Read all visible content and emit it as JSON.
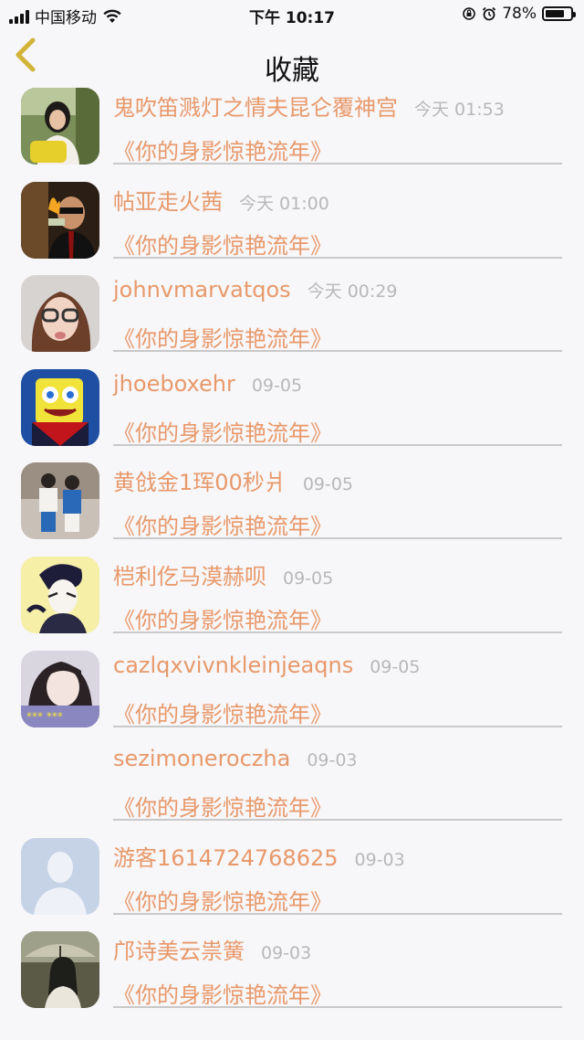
{
  "status_bar": {
    "carrier": "中国移动",
    "time": "下午 10:17",
    "battery": "78%",
    "battery_level": 0.78
  },
  "nav": {
    "title": "收藏"
  },
  "favorites": [
    {
      "name": "鬼吹笛溅灯之情夫昆仑覆神宫",
      "time": "今天 01:53",
      "work": "《你的身影惊艳流年》",
      "avatar": "avatar-girl-yellow-bag"
    },
    {
      "name": "帖亚走火茜",
      "time": "今天 01:00",
      "work": "《你的身影惊艳流年》",
      "avatar": "avatar-man-burning-money"
    },
    {
      "name": "johnvmarvatqos",
      "time": "今天 00:29",
      "work": "《你的身影惊艳流年》",
      "avatar": "avatar-girl-glasses"
    },
    {
      "name": "jhoeboxehr",
      "time": "09-05",
      "work": "《你的身影惊艳流年》",
      "avatar": "avatar-spongebob"
    },
    {
      "name": "黄戗金1珲00秒爿",
      "time": "09-05",
      "work": "《你的身影惊艳流年》",
      "avatar": "avatar-couple"
    },
    {
      "name": "桤利仡马漠赫呗",
      "time": "09-05",
      "work": "《你的身影惊艳流年》",
      "avatar": "avatar-drawn-boy"
    },
    {
      "name": "cazlqxvivnkleinjeaqns",
      "time": "09-05",
      "work": "《你的身影惊艳流年》",
      "avatar": "avatar-girl-dark-hair"
    },
    {
      "name": "sezimoneroczha",
      "time": "09-03",
      "work": "《你的身影惊艳流年》",
      "avatar": "none"
    },
    {
      "name": "游客1614724768625",
      "time": "09-03",
      "work": "《你的身影惊艳流年》",
      "avatar": "avatar-default-silhouette"
    },
    {
      "name": "邝诗美云祟簧",
      "time": "09-03",
      "work": "《你的身影惊艳流年》",
      "avatar": "avatar-girl-umbrella"
    }
  ],
  "colors": {
    "accent": "#e8996a",
    "muted": "#b8b8b8",
    "background": "#f7f6f9",
    "back_arrow": "#d2b437"
  }
}
